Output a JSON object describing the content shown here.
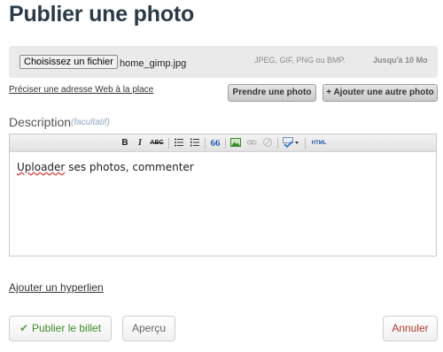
{
  "page": {
    "title": "Publier une photo"
  },
  "upload": {
    "choose_label": "Choisissez un fichier",
    "file_name": "home_gimp.jpg",
    "formats": "JPEG, GIF, PNG ou BMP.",
    "max_size": "Jusqu'à 10 Mo"
  },
  "actions": {
    "url_link": "Préciser une adresse Web à la place",
    "take_photo": "Prendre une photo",
    "add_photo": "+ Ajouter une autre photo"
  },
  "description": {
    "label": "Description",
    "optional": "(facultatif)",
    "text_word1": "Uploader",
    "text_rest": " ses photos, commenter"
  },
  "toolbar": {
    "bold": "B",
    "italic": "I",
    "strike": "ABC",
    "blockquote": "66",
    "html": "HTML"
  },
  "links": {
    "hyperlink": "Ajouter un hyperlien"
  },
  "buttons": {
    "publish": "Publier le billet",
    "preview": "Aperçu",
    "cancel": "Annuler"
  },
  "colors": {
    "title": "#2b3a48",
    "publish_text": "#3f8a28",
    "cancel_text": "#b3392f",
    "check": "#5aa33a"
  }
}
